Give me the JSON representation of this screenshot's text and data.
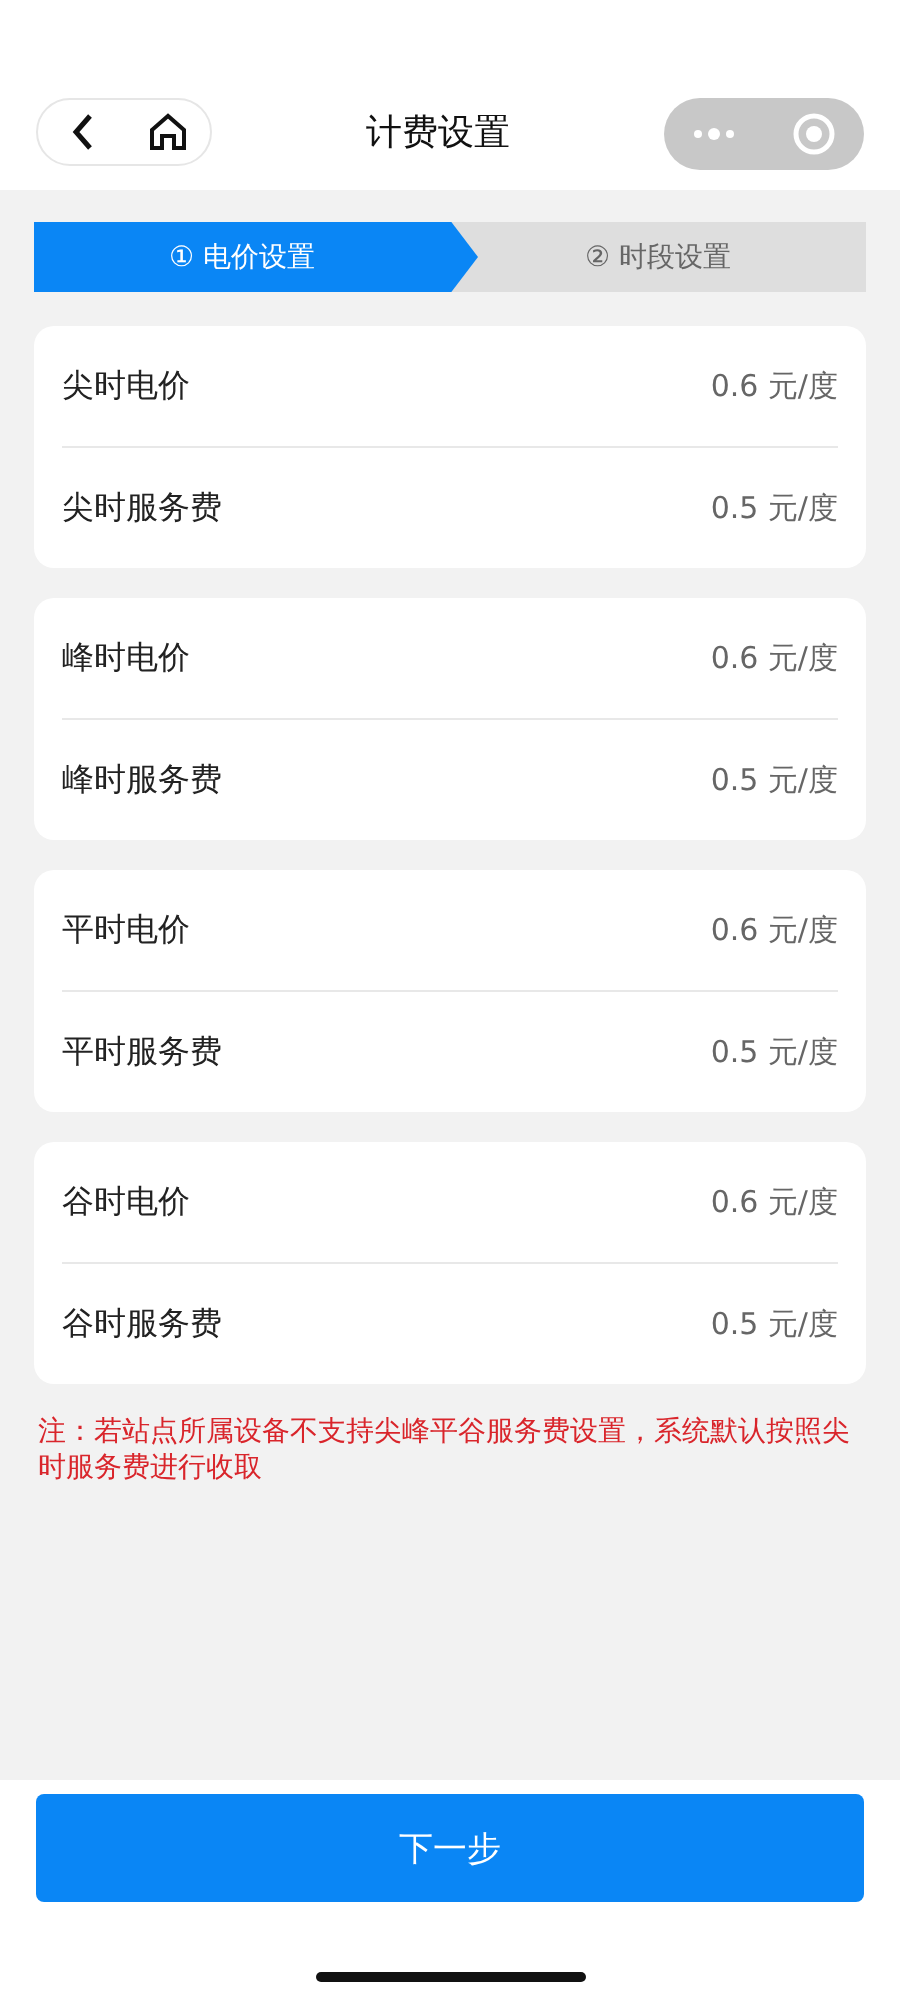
{
  "nav": {
    "title": "计费设置"
  },
  "steps": [
    {
      "label": "① 电价设置",
      "selected": true
    },
    {
      "label": "② 时段设置",
      "selected": false
    }
  ],
  "groups": [
    {
      "rows": [
        {
          "label": "尖时电价",
          "value": "0.6 元/度"
        },
        {
          "label": "尖时服务费",
          "value": "0.5 元/度"
        }
      ]
    },
    {
      "rows": [
        {
          "label": "峰时电价",
          "value": "0.6 元/度"
        },
        {
          "label": "峰时服务费",
          "value": "0.5 元/度"
        }
      ]
    },
    {
      "rows": [
        {
          "label": "平时电价",
          "value": "0.6 元/度"
        },
        {
          "label": "平时服务费",
          "value": "0.5 元/度"
        }
      ]
    },
    {
      "rows": [
        {
          "label": "谷时电价",
          "value": "0.6 元/度"
        },
        {
          "label": "谷时服务费",
          "value": "0.5 元/度"
        }
      ]
    }
  ],
  "note": "注：若站点所属设备不支持尖峰平谷服务费设置，系统默认按照尖时服务费进行收取",
  "next_button": "下一步"
}
